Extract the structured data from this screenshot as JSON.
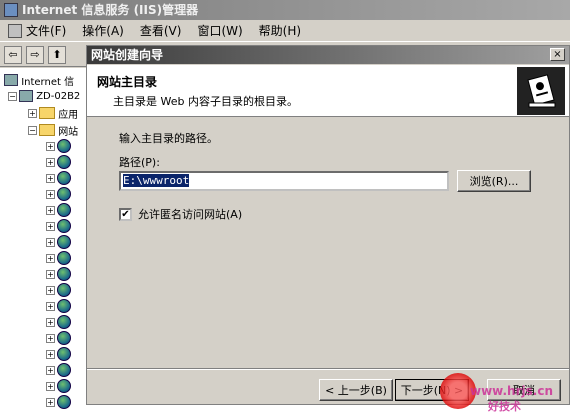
{
  "window": {
    "title": "Internet 信息服务 (IIS)管理器"
  },
  "menu": [
    "文件(F)",
    "操作(A)",
    "查看(V)",
    "窗口(W)",
    "帮助(H)"
  ],
  "toolbar": {
    "back": "⇦",
    "forward": "⇨",
    "up": "⬆"
  },
  "tree": {
    "root": "Internet 信",
    "server": "ZD-02B2",
    "app_pools": "应用",
    "websites": "网站"
  },
  "dialog": {
    "title": "网站创建向导",
    "close": "×",
    "header_title": "网站主目录",
    "header_subtitle": "主目录是 Web 内容子目录的根目录。",
    "instruction": "输入主目录的路径。",
    "path_label": "路径(P):",
    "path_value": "E:\\wwwroot",
    "browse_button": "浏览(R)...",
    "anonymous_checkbox": {
      "label": "允许匿名访问网站(A)",
      "checked": true
    },
    "back_button": "< 上一步(B)",
    "next_button": "下一步(N) >",
    "cancel_button": "取消"
  },
  "watermark": {
    "line1": "www.hrjs.cn",
    "line2": "好技术"
  }
}
